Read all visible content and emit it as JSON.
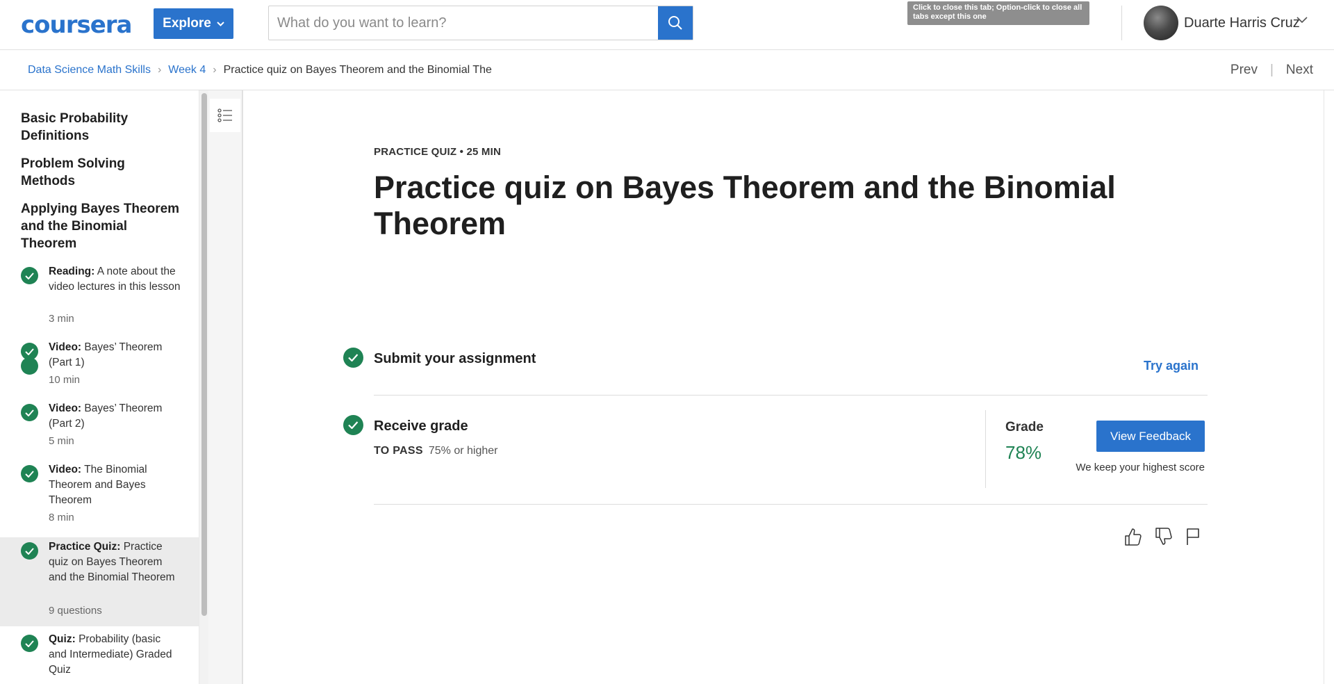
{
  "header": {
    "logo": "coursera",
    "explore_label": "Explore",
    "search_placeholder": "What do you want to learn?",
    "tooltip": "Click to close this tab; Option-click to close all tabs except this one",
    "user_name": "Duarte Harris Cruz",
    "brand_color": "#2a73cc"
  },
  "breadcrumb": {
    "items": [
      "Data Science Math Skills",
      "Week 4",
      "Practice quiz on Bayes Theorem and the Binomial The"
    ],
    "prev": "Prev",
    "next": "Next"
  },
  "sidebar": {
    "sections": [
      "Basic Probability Definitions",
      "Problem Solving Methods",
      "Applying Bayes Theorem and the Binomial Theorem"
    ],
    "items": [
      {
        "type": "Reading:",
        "title": "A note about the video lectures in this lesson",
        "meta": "3 min",
        "completed": true
      },
      {
        "type": "Video:",
        "title": "Bayes’ Theorem (Part 1)",
        "meta": "10 min",
        "completed": true
      },
      {
        "type": "Video:",
        "title": "Bayes’ Theorem (Part 2)",
        "meta": "5 min",
        "completed": true
      },
      {
        "type": "Video:",
        "title": "The Binomial Theorem and Bayes Theorem",
        "meta": "8 min",
        "completed": true
      },
      {
        "type": "Practice Quiz:",
        "title": "Practice quiz on Bayes Theorem and the Binomial Theorem",
        "meta": "9 questions",
        "completed": true,
        "active": true
      },
      {
        "type": "Quiz:",
        "title": "Probability (basic and Intermediate) Graded Quiz",
        "meta": "",
        "completed": true
      }
    ],
    "success_color": "#1f8354"
  },
  "main": {
    "eyebrow": "PRACTICE QUIZ • 25 MIN",
    "title": "Practice quiz on Bayes Theorem and the Binomial Theorem",
    "submit_step": "Submit your assignment",
    "try_again": "Try again",
    "grade_step": "Receive grade",
    "to_pass_label": "TO PASS",
    "to_pass_value": "75% or higher",
    "grade_label": "Grade",
    "grade_value": "78%",
    "view_feedback": "View Feedback",
    "keep_note": "We keep your highest score",
    "action_icons": [
      "thumbs-up-icon",
      "thumbs-down-icon",
      "flag-icon"
    ]
  }
}
